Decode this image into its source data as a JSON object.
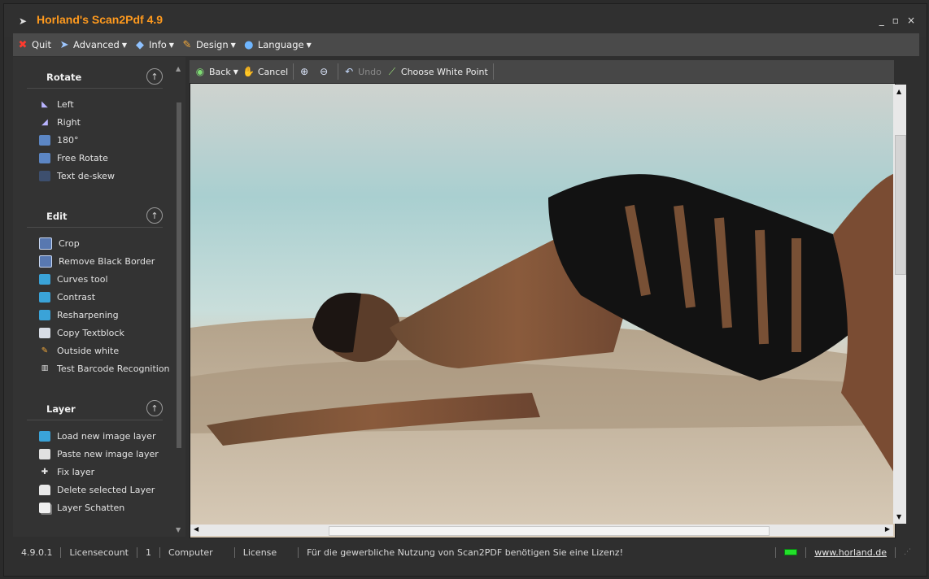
{
  "app": {
    "title": "Horland's Scan2Pdf 4.9",
    "window_controls": [
      "_",
      "▫",
      "×"
    ]
  },
  "menubar": [
    {
      "label": "Quit",
      "icon": "close-x-icon",
      "dropdown": false
    },
    {
      "label": "Advanced",
      "icon": "advanced-icon",
      "dropdown": true
    },
    {
      "label": "Info",
      "icon": "info-diamond-icon",
      "dropdown": true
    },
    {
      "label": "Design",
      "icon": "design-brush-icon",
      "dropdown": true
    },
    {
      "label": "Language",
      "icon": "globe-icon",
      "dropdown": true
    }
  ],
  "sidebar": {
    "sections": [
      {
        "title": "Rotate",
        "items": [
          {
            "label": "Left",
            "icon": "rotate-left-icon"
          },
          {
            "label": "Right",
            "icon": "rotate-right-icon"
          },
          {
            "label": "180°",
            "icon": "rotate-180-icon"
          },
          {
            "label": "Free Rotate",
            "icon": "free-rotate-icon"
          },
          {
            "label": "Text de-skew",
            "icon": "deskew-icon"
          }
        ]
      },
      {
        "title": "Edit",
        "items": [
          {
            "label": "Crop",
            "icon": "crop-icon"
          },
          {
            "label": "Remove Black Border",
            "icon": "border-icon"
          },
          {
            "label": "Curves tool",
            "icon": "curves-icon"
          },
          {
            "label": "Contrast",
            "icon": "contrast-icon"
          },
          {
            "label": "Resharpening",
            "icon": "sharpen-icon"
          },
          {
            "label": "Copy Textblock",
            "icon": "copy-text-icon"
          },
          {
            "label": "Outside white",
            "icon": "outside-white-icon"
          },
          {
            "label": "Test Barcode Recognition",
            "icon": "barcode-icon"
          }
        ]
      },
      {
        "title": "Layer",
        "items": [
          {
            "label": "Load new image layer",
            "icon": "load-layer-icon"
          },
          {
            "label": "Paste new image layer",
            "icon": "paste-layer-icon"
          },
          {
            "label": "Fix layer",
            "icon": "pin-icon"
          },
          {
            "label": "Delete selected Layer",
            "icon": "trash-icon"
          },
          {
            "label": "Layer Schatten",
            "icon": "shadow-layer-icon"
          }
        ]
      }
    ]
  },
  "toolbar": {
    "back": "Back",
    "cancel": "Cancel",
    "undo": "Undo",
    "white_point": "Choose White Point"
  },
  "status": {
    "version": "4.9.0.1",
    "licensecount_label": "Licensecount",
    "licensecount_value": "1",
    "computer": "Computer",
    "license": "License",
    "message": "Für die gewerbliche Nutzung von Scan2PDF benötigen Sie eine Lizenz!",
    "link": "www.horland.de"
  },
  "colors": {
    "title_accent": "#ff9a1e",
    "status_led": "#22e02a",
    "panel": "#333333",
    "menubar": "#4a4a4a"
  }
}
